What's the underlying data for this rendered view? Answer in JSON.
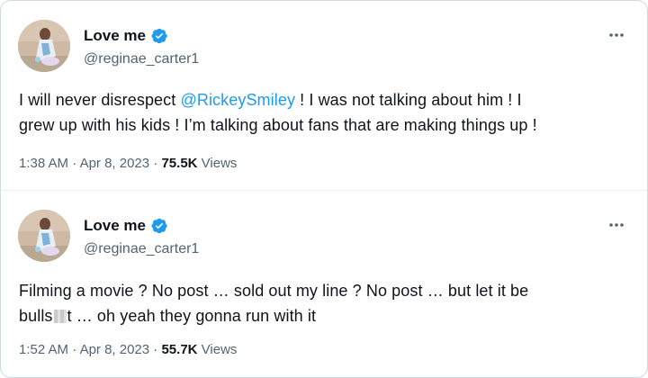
{
  "tweets": [
    {
      "display_name": "Love me",
      "handle": "@reginae_carter1",
      "text": {
        "before_mention": "I will never disrespect ",
        "mention": "@RickeySmiley",
        "line1_rest": " ! I was not talking about him ! I",
        "line2": "grew up with his kids ! I’m talking about fans that are making things up !"
      },
      "time": "1:38 AM",
      "separator": " · ",
      "date": "Apr 8, 2023",
      "views_count": "75.5K",
      "views_label": " Views"
    },
    {
      "display_name": "Love me",
      "handle": "@reginae_carter1",
      "text": {
        "line1": "Filming a movie ? No post … sold out my line ? No post … but let it be",
        "censored_prefix": "bulls",
        "censored_suffix": "t … oh yeah they gonna run with it"
      },
      "time": "1:52 AM",
      "separator": " · ",
      "date": "Apr 8, 2023",
      "views_count": "55.7K",
      "views_label": " Views"
    }
  ],
  "icons": {
    "verified": "verified-badge-icon",
    "more": "more-options-icon"
  },
  "colors": {
    "link": "#1d9bf0",
    "secondary_text": "#536471",
    "primary_text": "#0f1419",
    "border": "#cfd9de"
  }
}
